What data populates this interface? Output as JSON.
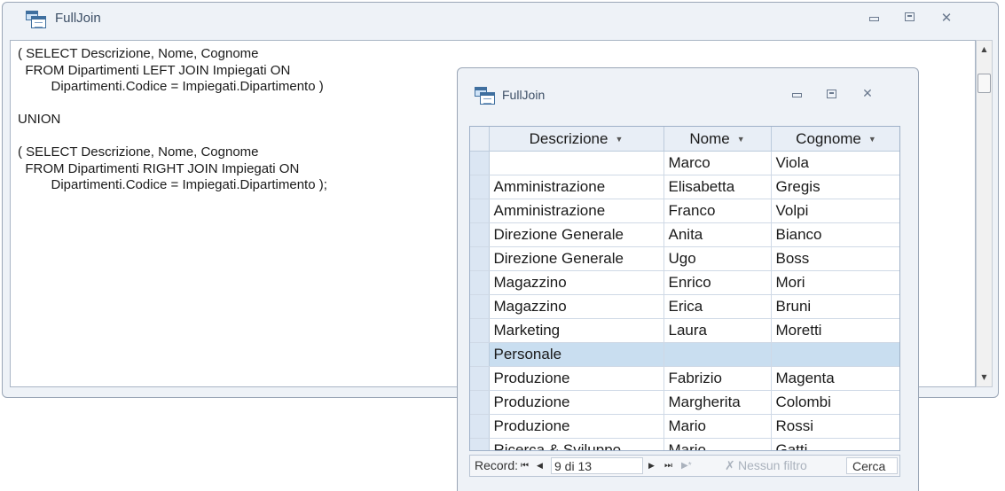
{
  "sql_window": {
    "title": "FullJoin",
    "controls": {
      "minimize": "minimize",
      "maximize": "maximize",
      "close": "✕"
    },
    "sql": "( SELECT Descrizione, Nome, Cognome\n  FROM Dipartimenti LEFT JOIN Impiegati ON\n         Dipartimenti.Codice = Impiegati.Dipartimento )\n\nUNION\n\n( SELECT Descrizione, Nome, Cognome\n  FROM Dipartimenti RIGHT JOIN Impiegati ON\n         Dipartimenti.Codice = Impiegati.Dipartimento );",
    "scrollbar": {
      "up": "▲",
      "down": "▼"
    }
  },
  "result_window": {
    "title": "FullJoin",
    "controls": {
      "close": "✕"
    },
    "columns": [
      {
        "label": "Descrizione",
        "dropdown": "▼"
      },
      {
        "label": "Nome",
        "dropdown": "▼"
      },
      {
        "label": "Cognome",
        "dropdown": "▼"
      }
    ],
    "rows": [
      [
        "",
        "Marco",
        "Viola"
      ],
      [
        "Amministrazione",
        "Elisabetta",
        "Gregis"
      ],
      [
        "Amministrazione",
        "Franco",
        "Volpi"
      ],
      [
        "Direzione  Generale",
        "Anita",
        "Bianco"
      ],
      [
        "Direzione  Generale",
        "Ugo",
        "Boss"
      ],
      [
        "Magazzino",
        "Enrico",
        "Mori"
      ],
      [
        "Magazzino",
        "Erica",
        "Bruni"
      ],
      [
        "Marketing",
        "Laura",
        "Moretti"
      ],
      [
        "Personale",
        "",
        ""
      ],
      [
        "Produzione",
        "Fabrizio",
        "Magenta"
      ],
      [
        "Produzione",
        "Margherita",
        "Colombi"
      ],
      [
        "Produzione",
        "Mario",
        "Rossi"
      ],
      [
        "Ricerca & Sviluppo",
        "Mario",
        "Gatti"
      ]
    ],
    "current_row_index": 8,
    "nav": {
      "label": "Record:",
      "first": "⏮",
      "prev": "◀",
      "position": "9 di 13",
      "next": "▶",
      "last": "⏭",
      "new": "▶*",
      "filter_icon": "✗",
      "filter": "Nessun filtro",
      "search": "Cerca"
    }
  },
  "colors": {
    "window_bg": "#eef2f7",
    "title_text": "#3d4f66",
    "header_bg": "#e8eef6",
    "current_row": "#c9def0",
    "grid_line": "#cfd9e6"
  }
}
